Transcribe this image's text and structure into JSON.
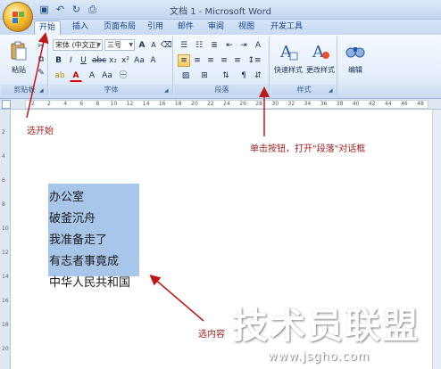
{
  "window": {
    "title": "文档 1 - Microsoft Word"
  },
  "qat": {
    "icons": [
      "save-icon",
      "undo-icon",
      "redo-icon",
      "print-preview-icon"
    ]
  },
  "tabs": [
    {
      "label": "开始",
      "active": true
    },
    {
      "label": "插入"
    },
    {
      "label": "页面布局"
    },
    {
      "label": "引用"
    },
    {
      "label": "邮件"
    },
    {
      "label": "审阅"
    },
    {
      "label": "视图"
    },
    {
      "label": "开发工具"
    }
  ],
  "ribbon": {
    "clipboard": {
      "label": "剪贴板",
      "paste_label": "粘贴"
    },
    "font": {
      "label": "字体",
      "font_name": "宋体 (中文正)",
      "font_size": "三号"
    },
    "paragraph": {
      "label": "段落"
    },
    "styles": {
      "label": "样式",
      "quick_styles": "快速样式",
      "change_styles": "更改样式"
    },
    "editing": {
      "label": "编辑"
    }
  },
  "ruler": {
    "numbers": [
      "2",
      "2",
      "4",
      "6",
      "8",
      "10",
      "12",
      "14",
      "16",
      "18",
      "20",
      "22",
      "24",
      "26",
      "28",
      "30",
      "32",
      "34",
      "36",
      "38",
      "40",
      "42",
      "44",
      "46",
      "48"
    ]
  },
  "vruler": {
    "numbers": [
      "2",
      "4",
      "6",
      "8",
      "10",
      "12",
      "14",
      "16",
      "18",
      "20"
    ]
  },
  "document": {
    "lines": [
      "办公室",
      "破釜沉舟",
      "我准备走了",
      "有志者事竟成",
      "中华人民共和国"
    ]
  },
  "annotations": {
    "select_start": "选开始",
    "click_button": "单击按钮，打开\"段落\"对话框",
    "select_content": "选内容"
  },
  "watermark": {
    "title": "技术员联盟",
    "url": "www.jsgho.com"
  },
  "colors": {
    "selection": "#a7c6ea",
    "annotation": "#a02020",
    "ribbon_accent": "#15428b"
  }
}
